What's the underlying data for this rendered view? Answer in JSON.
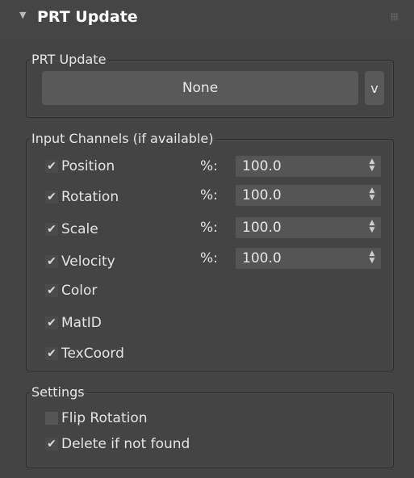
{
  "rollout": {
    "title": "PRT Update",
    "collapse_icon": "triangle-down-icon",
    "grip_icon": "grip-dots-icon"
  },
  "prt_update": {
    "legend": "PRT Update",
    "selected_label": "None",
    "dropdown_label": "v"
  },
  "input_channels": {
    "legend": "Input Channels (if available)",
    "percent_label": "%:",
    "channels": [
      {
        "label": "Position",
        "checked": true,
        "percent": "100.0"
      },
      {
        "label": "Rotation",
        "checked": true,
        "percent": "100.0"
      },
      {
        "label": "Scale",
        "checked": true,
        "percent": "100.0"
      },
      {
        "label": "Velocity",
        "checked": true,
        "percent": "100.0"
      },
      {
        "label": "Color",
        "checked": true
      },
      {
        "label": "MatID",
        "checked": true
      },
      {
        "label": "TexCoord",
        "checked": true
      }
    ]
  },
  "settings": {
    "legend": "Settings",
    "options": [
      {
        "label": "Flip Rotation",
        "checked": false
      },
      {
        "label": "Delete if not found",
        "checked": true
      }
    ]
  },
  "glyphs": {
    "check": "✔",
    "spin_up": "▲",
    "spin_down": "▼"
  },
  "colors": {
    "panel_bg": "#444444",
    "field_bg": "#555555",
    "button_bg": "#595959",
    "text": "#e4e4e4"
  }
}
